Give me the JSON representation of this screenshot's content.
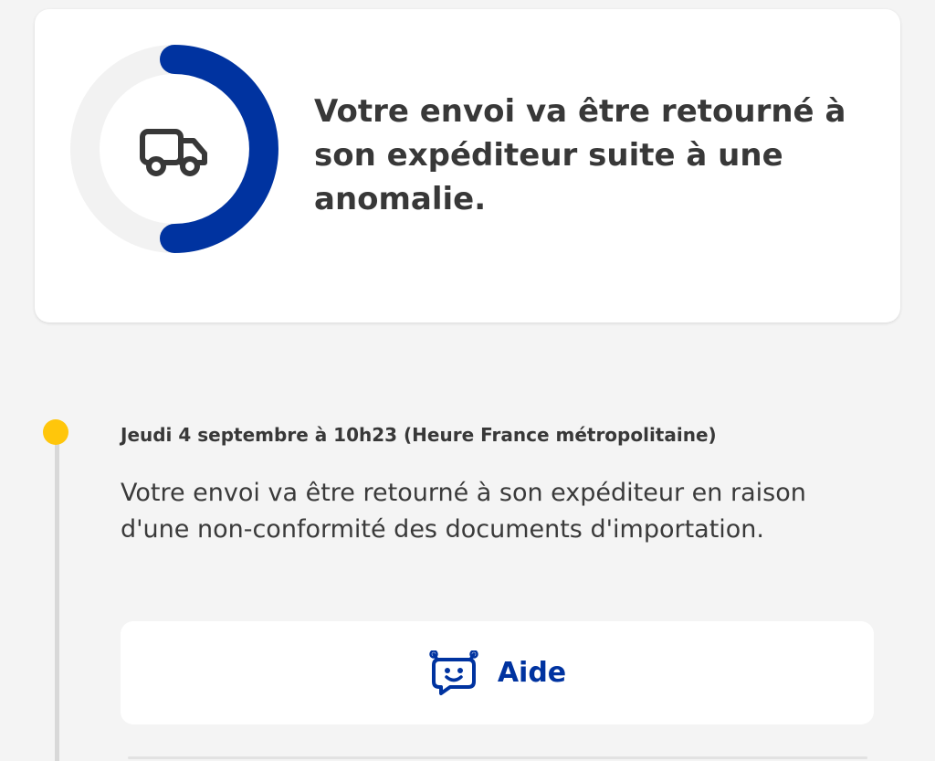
{
  "status_card": {
    "message": "Votre envoi va être retourné à son expéditeur suite à une anomalie.",
    "progress_fraction": 0.5,
    "icon": "truck-icon",
    "ring_color": "#0033a0",
    "ring_track_color": "#f2f2f2"
  },
  "timeline": {
    "dot_color": "#ffc60b",
    "events": [
      {
        "date": "Jeudi 4 septembre à 10h23 (Heure France métropolitaine)",
        "description": "Votre envoi va être retourné à son expéditeur en raison d'une non-conformité des documents d'importation."
      }
    ]
  },
  "help_button": {
    "label": "Aide",
    "icon": "chatbot-icon",
    "color": "#0033a0"
  }
}
